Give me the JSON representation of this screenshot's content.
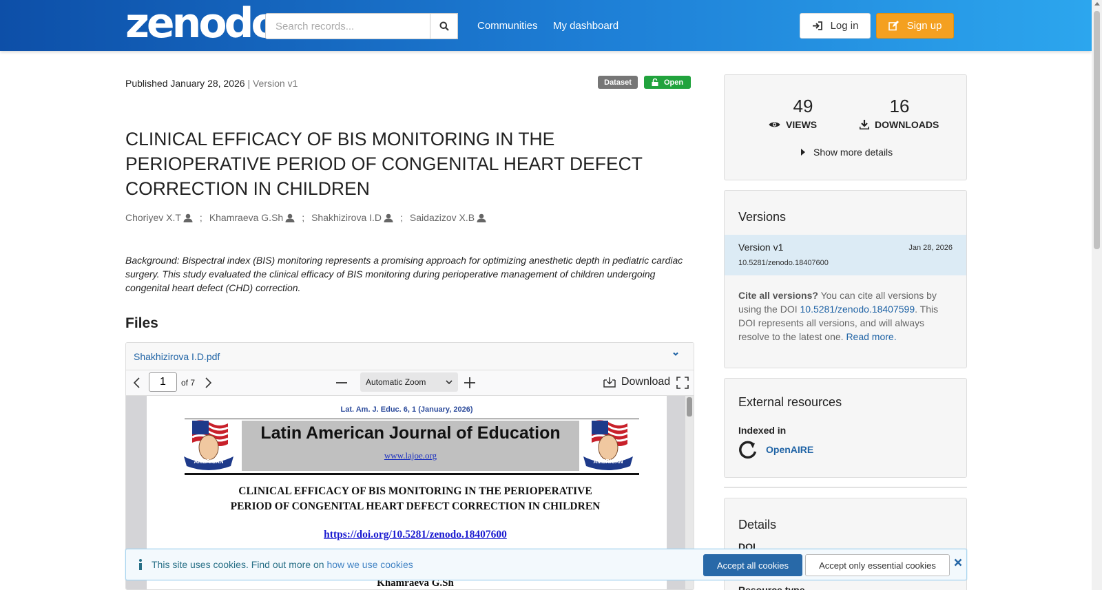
{
  "header": {
    "logo_text": "zenodo",
    "search_placeholder": "Search records...",
    "nav": [
      "Communities",
      "My dashboard"
    ],
    "login_label": "Log in",
    "signup_label": "Sign up"
  },
  "record": {
    "published": "Published January 28, 2026",
    "version": "| Version v1",
    "badge_type": "Dataset",
    "badge_access": "Open",
    "title": "CLINICAL EFFICACY OF BIS MONITORING IN THE PERIOPERATIVE PERIOD OF CONGENITAL HEART DEFECT CORRECTION IN CHILDREN",
    "authors": [
      "Choriyev X.T",
      "Khamraeva G.Sh",
      "Shakhizirova I.D",
      "Saidazizov X.B"
    ],
    "abstract": "Background: Bispectral index (BIS) monitoring represents a promising approach for optimizing anesthetic depth in pediatric cardiac surgery. This study evaluated the clinical efficacy of BIS monitoring during perioperative management of children undergoing congenital heart defect (CHD) correction."
  },
  "files": {
    "heading": "Files",
    "file_name": "Shakhizirova I.D.pdf",
    "viewer": {
      "page_number": "1",
      "of_pages": "of 7",
      "zoom": "Automatic Zoom",
      "download_label": "Download"
    },
    "pdf": {
      "journal_ref": "Lat. Am. J. Educ. 6, 1 (January, 2026)",
      "journal_title": "Latin American Journal of Education",
      "journal_url": "www.lajoe.org",
      "flag_text": "AMERICAN",
      "paper_title_1": "CLINICAL EFFICACY OF BIS MONITORING IN THE PERIOPERATIVE",
      "paper_title_2": "PERIOD OF CONGENITAL HEART DEFECT CORRECTION IN CHILDREN",
      "paper_doi": "https://doi.org/10.5281/zenodo.18407600",
      "paper_author": "Khamraeva G.Sh"
    }
  },
  "stats": {
    "views_count": "49",
    "views_label": "VIEWS",
    "downloads_count": "16",
    "downloads_label": "DOWNLOADS",
    "more_details": "Show more details"
  },
  "versions": {
    "heading": "Versions",
    "current_name": "Version v1",
    "current_date": "Jan 28, 2026",
    "current_doi": "10.5281/zenodo.18407600",
    "cite_bold": "Cite all versions?",
    "cite_text_1": " You can cite all versions by using the DOI ",
    "cite_doi": "10.5281/zenodo.18407599",
    "cite_text_2": ". This DOI represents all versions, and will always resolve to the latest one. ",
    "read_more": "Read more."
  },
  "external": {
    "heading": "External resources",
    "indexed_in": "Indexed in",
    "resource": "OpenAIRE"
  },
  "details": {
    "heading": "Details",
    "doi_label": "DOI",
    "resource_type_label": "Resource type"
  },
  "cookie": {
    "text": "This site uses cookies. Find out more on ",
    "link": "how we use cookies",
    "accept_all": "Accept all cookies",
    "accept_essential": "Accept only essential cookies"
  },
  "colors": {
    "header_start": "#0d4fa8",
    "header_end": "#2ca6ee",
    "signup": "#f4a020",
    "open_badge": "#21a33d",
    "link": "#1f63a5"
  }
}
